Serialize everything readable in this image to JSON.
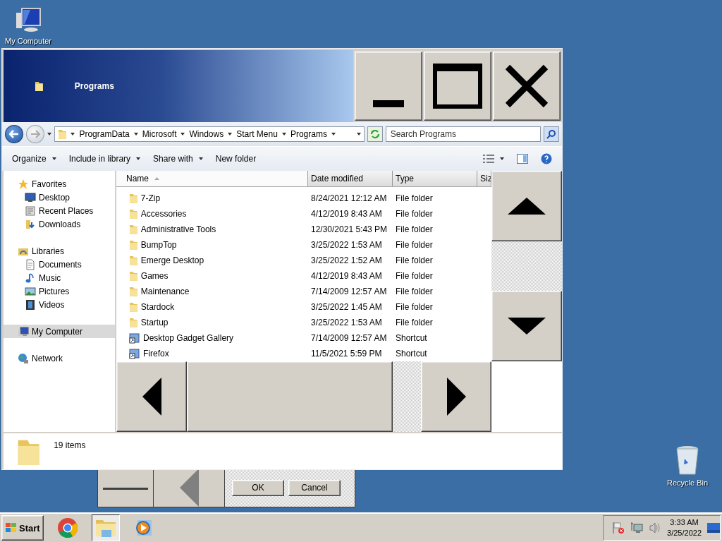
{
  "desktop_icons": [
    {
      "label": "My Computer"
    },
    {
      "label": "Recycle Bin"
    }
  ],
  "window": {
    "title": "Programs",
    "breadcrumb": [
      "ProgramData",
      "Microsoft",
      "Windows",
      "Start Menu",
      "Programs"
    ],
    "search": {
      "placeholder": "Search Programs"
    },
    "commands": [
      {
        "label": "Organize",
        "menu": true
      },
      {
        "label": "Include in library",
        "menu": true
      },
      {
        "label": "Share with",
        "menu": true
      },
      {
        "label": "New folder",
        "menu": false
      }
    ],
    "nav": [
      {
        "label": "Favorites",
        "selected": false,
        "children": [
          {
            "label": "Desktop",
            "selected": false
          },
          {
            "label": "Recent Places",
            "selected": false
          },
          {
            "label": "Downloads",
            "selected": false
          }
        ]
      },
      {
        "label": "Libraries",
        "selected": false,
        "children": [
          {
            "label": "Documents",
            "selected": false
          },
          {
            "label": "Music",
            "selected": false
          },
          {
            "label": "Pictures",
            "selected": false
          },
          {
            "label": "Videos",
            "selected": false
          }
        ]
      },
      {
        "label": "My Computer",
        "selected": true
      },
      {
        "label": "Network",
        "selected": false
      }
    ],
    "columns": [
      {
        "label": "Name",
        "sorted": true
      },
      {
        "label": "Date modified",
        "sorted": false
      },
      {
        "label": "Type",
        "sorted": false
      },
      {
        "label": "Siz",
        "sorted": false
      }
    ],
    "rows": [
      {
        "name": "7-Zip",
        "date": "8/24/2021 12:12 AM",
        "type": "File folder",
        "kind": "folder"
      },
      {
        "name": "Accessories",
        "date": "4/12/2019 8:43 AM",
        "type": "File folder",
        "kind": "folder"
      },
      {
        "name": "Administrative Tools",
        "date": "12/30/2021 5:43 PM",
        "type": "File folder",
        "kind": "folder"
      },
      {
        "name": "BumpTop",
        "date": "3/25/2022 1:53 AM",
        "type": "File folder",
        "kind": "folder"
      },
      {
        "name": "Emerge Desktop",
        "date": "3/25/2022 1:52 AM",
        "type": "File folder",
        "kind": "folder"
      },
      {
        "name": "Games",
        "date": "4/12/2019 8:43 AM",
        "type": "File folder",
        "kind": "folder"
      },
      {
        "name": "Maintenance",
        "date": "7/14/2009 12:57 AM",
        "type": "File folder",
        "kind": "folder"
      },
      {
        "name": "Stardock",
        "date": "3/25/2022 1:45 AM",
        "type": "File folder",
        "kind": "folder"
      },
      {
        "name": "Startup",
        "date": "3/25/2022 1:53 AM",
        "type": "File folder",
        "kind": "folder"
      },
      {
        "name": "Desktop Gadget Gallery",
        "date": "7/14/2009 12:57 AM",
        "type": "Shortcut",
        "kind": "shortcut"
      },
      {
        "name": "Firefox",
        "date": "11/5/2021 5:59 PM",
        "type": "Shortcut",
        "kind": "shortcut"
      }
    ],
    "status": "19 items"
  },
  "dialog": {
    "buttons": [
      "OK",
      "Cancel"
    ]
  },
  "taskbar": {
    "start": "Start",
    "apps": [
      {
        "kind": "browser",
        "selected": false
      },
      {
        "kind": "explorer",
        "selected": true
      },
      {
        "kind": "media",
        "selected": false
      }
    ],
    "time": "3:33 AM",
    "date": "3/25/2022"
  }
}
